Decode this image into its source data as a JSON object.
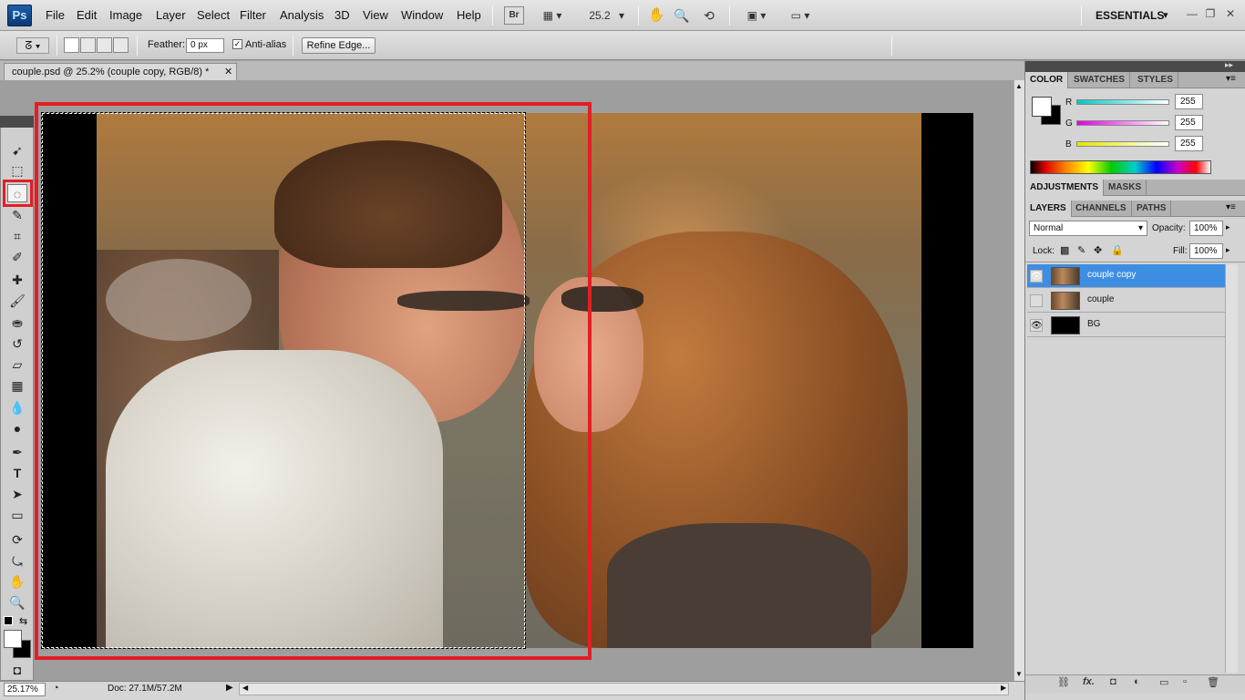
{
  "app": {
    "logo": "Ps"
  },
  "menu": [
    "File",
    "Edit",
    "Image",
    "Layer",
    "Select",
    "Filter",
    "Analysis",
    "3D",
    "View",
    "Window",
    "Help"
  ],
  "appbar": {
    "bridge": "Br",
    "zoom": "25.2",
    "workspace": "ESSENTIALS",
    "min": "—",
    "restore": "❐",
    "close": "✕"
  },
  "options": {
    "feather_label": "Feather:",
    "feather_value": "0 px",
    "antialias_label": "Anti-alias",
    "antialias_checked": "✓",
    "refine_label": "Refine Edge..."
  },
  "document": {
    "tab_title": "couple.psd @ 25.2% (couple copy, RGB/8) *",
    "tab_close": "✕"
  },
  "status": {
    "zoom": "25.17%",
    "doc": "Doc: 27.1M/57.2M"
  },
  "color_panel": {
    "tabs": [
      "COLOR",
      "SWATCHES",
      "STYLES"
    ],
    "channels": [
      {
        "label": "R",
        "value": "255",
        "color": "#00c8c8"
      },
      {
        "label": "G",
        "value": "255",
        "color": "#e000e0"
      },
      {
        "label": "B",
        "value": "255",
        "color": "#e6e600"
      }
    ]
  },
  "adjust_panel": {
    "tabs": [
      "ADJUSTMENTS",
      "MASKS"
    ]
  },
  "layers_panel": {
    "tabs": [
      "LAYERS",
      "CHANNELS",
      "PATHS"
    ],
    "blend_mode": "Normal",
    "opacity_label": "Opacity:",
    "opacity": "100%",
    "lock_label": "Lock:",
    "fill_label": "Fill:",
    "fill": "100%",
    "layers": [
      {
        "name": "couple copy",
        "visible": "👁",
        "selected": true
      },
      {
        "name": "couple",
        "visible": "",
        "selected": false
      },
      {
        "name": "BG",
        "visible": "👁",
        "selected": false
      }
    ],
    "footer_icons": [
      "link-icon",
      "fx-icon",
      "mask-icon",
      "adjustment-icon",
      "group-icon",
      "new-layer-icon",
      "trash-icon"
    ],
    "footer_glyphs": [
      "⛓",
      "fx.",
      "◘",
      "◐",
      "▭",
      "▫",
      "🗑"
    ]
  },
  "colors": {
    "highlight": "#e31e24",
    "selected_layer": "#3d8ee3"
  }
}
